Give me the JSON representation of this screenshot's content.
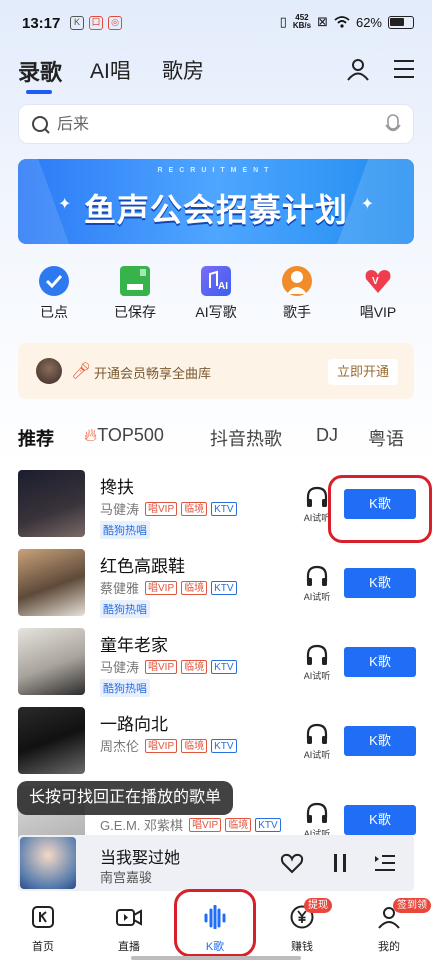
{
  "status": {
    "time": "13:17",
    "speed_value": "452",
    "speed_unit": "KB/s",
    "battery": "62%"
  },
  "header": {
    "tabs": [
      {
        "label": "录歌"
      },
      {
        "label": "AI唱"
      },
      {
        "label": "歌房"
      }
    ]
  },
  "search": {
    "placeholder": "后来"
  },
  "banner": {
    "subtitle": "RECRUITMENT",
    "title": "鱼声公会招募计划"
  },
  "quick": [
    {
      "label": "已点"
    },
    {
      "label": "已保存"
    },
    {
      "label": "AI写歌"
    },
    {
      "label": "歌手"
    },
    {
      "label": "唱VIP"
    }
  ],
  "vip_promo": {
    "text": "开通会员畅享全曲库",
    "button": "立即开通"
  },
  "categories": [
    {
      "label": "推荐"
    },
    {
      "label": "TOP500"
    },
    {
      "label": "抖音热歌"
    },
    {
      "label": "DJ"
    },
    {
      "label": "粤语"
    }
  ],
  "songs": [
    {
      "title": "搀扶",
      "artist": "马健涛",
      "tags": [
        "唱VIP",
        "临境",
        "KTV"
      ],
      "hot": "酷狗热唱",
      "ai": "AI试听",
      "button": "K歌"
    },
    {
      "title": "红色高跟鞋",
      "artist": "蔡健雅",
      "tags": [
        "唱VIP",
        "临境",
        "KTV"
      ],
      "hot": "酷狗热唱",
      "ai": "AI试听",
      "button": "K歌"
    },
    {
      "title": "童年老家",
      "artist": "马健涛",
      "tags": [
        "唱VIP",
        "临境",
        "KTV"
      ],
      "hot": "酷狗热唱",
      "ai": "AI试听",
      "button": "K歌"
    },
    {
      "title": "一路向北",
      "artist": "周杰伦",
      "tags": [
        "唱VIP",
        "临境",
        "KTV"
      ],
      "hot": "",
      "ai": "AI试听",
      "button": "K歌"
    },
    {
      "title": "",
      "artist": "G.E.M. 邓紫棋",
      "tags": [
        "唱VIP",
        "临境",
        "KTV"
      ],
      "hot": "",
      "ai": "AI试听",
      "button": "K歌"
    }
  ],
  "toast": "长按可找回正在播放的歌单",
  "player": {
    "title": "当我娶过她",
    "artist": "南宫嘉骏"
  },
  "nav": [
    {
      "label": "首页"
    },
    {
      "label": "直播"
    },
    {
      "label": "K歌"
    },
    {
      "label": "赚钱",
      "badge": "提现"
    },
    {
      "label": "我的",
      "badge": "签到领"
    }
  ]
}
